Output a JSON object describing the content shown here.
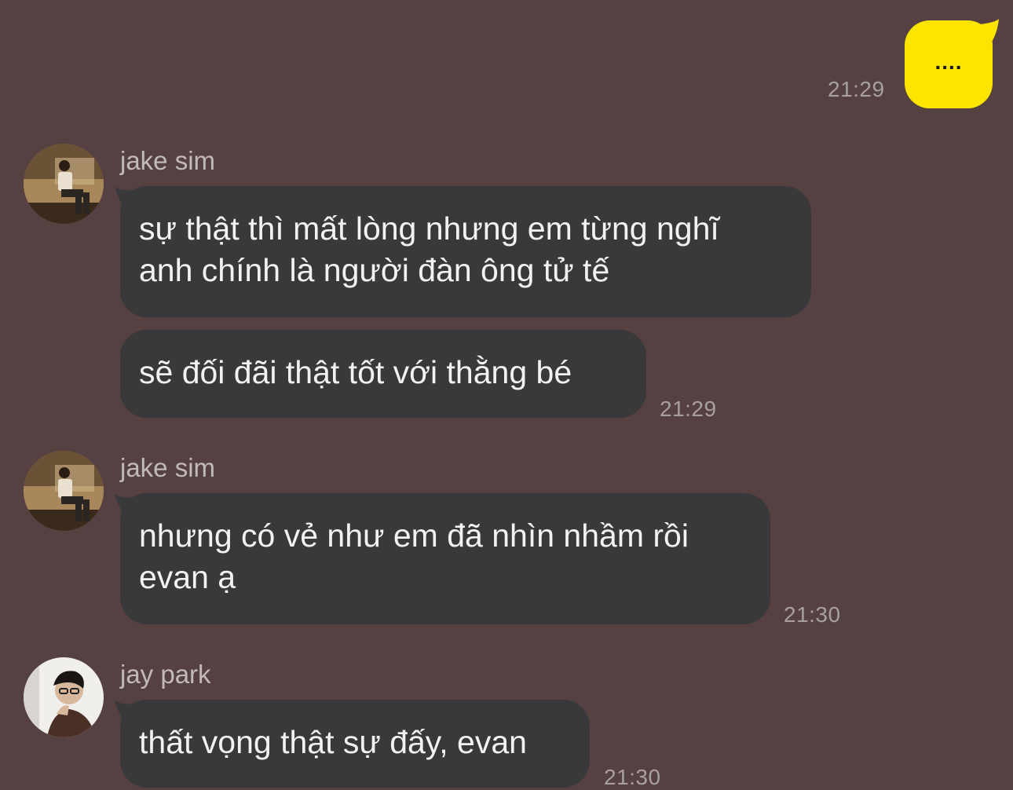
{
  "outgoing": {
    "text": "....",
    "time": "21:29"
  },
  "messages": [
    {
      "sender": "jake sim",
      "bubbles": [
        "sự thật thì mất lòng nhưng em từng nghĩ\nanh chính là người đàn ông tử tế",
        "sẽ đối đãi thật tốt với thằng bé"
      ],
      "time": "21:29"
    },
    {
      "sender": "jake sim",
      "bubbles": [
        "nhưng có vẻ như em đã nhìn nhầm rồi\nevan ạ"
      ],
      "time": "21:30"
    },
    {
      "sender": "jay park",
      "bubbles": [
        "thất vọng thật sự đấy, evan"
      ],
      "time": "21:30"
    }
  ],
  "colors": {
    "background": "#554042",
    "outgoing_bubble": "#fee500",
    "incoming_bubble": "#39383b"
  }
}
